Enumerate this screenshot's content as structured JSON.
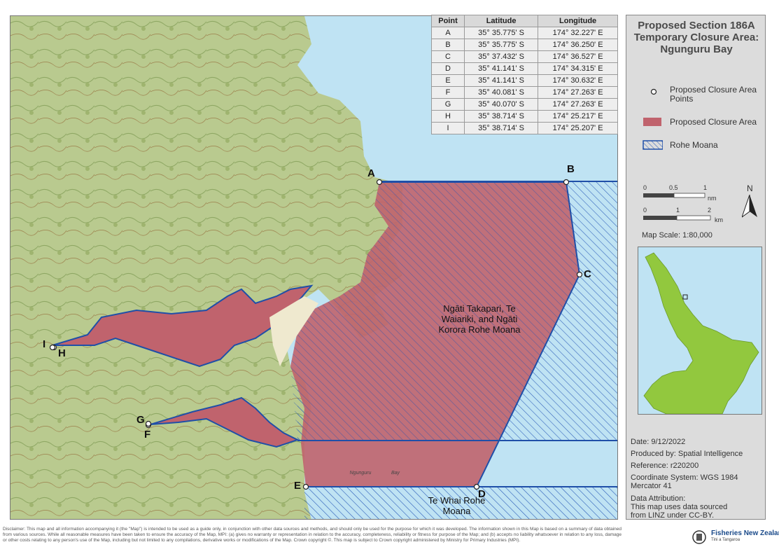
{
  "table": {
    "headers": [
      "Point",
      "Latitude",
      "Longitude"
    ],
    "rows": [
      [
        "A",
        "35° 35.775' S",
        "174° 32.227' E"
      ],
      [
        "B",
        "35° 35.775' S",
        "174° 36.250' E"
      ],
      [
        "C",
        "35° 37.432' S",
        "174° 36.527' E"
      ],
      [
        "D",
        "35° 41.141' S",
        "174° 34.315' E"
      ],
      [
        "E",
        "35° 41.141' S",
        "174° 30.632' E"
      ],
      [
        "F",
        "35° 40.081' S",
        "174° 27.263' E"
      ],
      [
        "G",
        "35° 40.070' S",
        "174° 27.263' E"
      ],
      [
        "H",
        "35° 38.714' S",
        "174° 25.217' E"
      ],
      [
        "I",
        "35° 38.714' S",
        "174° 25.207' E"
      ]
    ]
  },
  "panel": {
    "title": "Proposed Section 186A Temporary Closure Area: Ngunguru Bay",
    "legend": {
      "points": "Proposed Closure Area Points",
      "area": "Proposed Closure Area",
      "rohe": "Rohe Moana"
    },
    "scale_nm": [
      "0",
      "0.5",
      "1",
      "nm"
    ],
    "scale_km": [
      "0",
      "1",
      "2",
      "km"
    ],
    "north": "N",
    "map_scale": "Map Scale: 1:80,000",
    "date": "Date: 9/12/2022",
    "produced_by": "Produced by: Spatial Intelligence",
    "reference": "Reference: r220200",
    "coordinate_system": "Coordinate System: WGS 1984 Mercator 41",
    "attribution_title": "Data Attribution:",
    "attribution_text": "This map uses data sourced from LINZ under CC-BY."
  },
  "map": {
    "point_labels": [
      "A",
      "B",
      "C",
      "D",
      "E",
      "F",
      "G",
      "H",
      "I"
    ],
    "rohe_north": "Ngāti Takapari, Te Waiariki, and Ngāti Korora Rohe Moana",
    "rohe_south": "Te Whai Rohe Moana",
    "bay_label_1": "Ngunguru",
    "bay_label_2": "Bay",
    "colors": {
      "sea": "#bfe3f3",
      "land": "#b7c98e",
      "closure_area": "#c0636d",
      "rohe_boundary": "#1f4fa8"
    }
  },
  "disclaimer": "Disclaimer: This map and all information accompanying it (the \"Map\") is intended to be used as a guide only, in conjunction with other data sources and methods, and should only be used for the purpose for which it was developed. The information shown in this Map is based on a summary of data obtained from various sources. While all reasonable measures have been taken to ensure the accuracy of the Map, MPI: (a) gives no warranty or representation in relation to the accuracy, completeness, reliability or fitness for purpose of the Map; and (b) accepts no liability whatsoever in relation to any loss, damage or other costs relating to any person's use of the Map, including but not limited to any compilations, derivative works or modifications of the Map. Crown copyright ©. This map is subject to Crown copyright administered by Ministry for Primary Industries (MPI).",
  "logo": {
    "name": "Fisheries New Zealand",
    "sub": "Tini a Tangaroa"
  }
}
